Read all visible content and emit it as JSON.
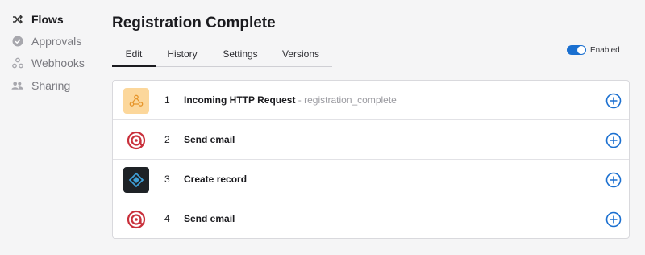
{
  "sidebar": {
    "items": [
      {
        "label": "Flows",
        "icon": "shuffle-icon",
        "active": true
      },
      {
        "label": "Approvals",
        "icon": "check-circle-icon",
        "active": false
      },
      {
        "label": "Webhooks",
        "icon": "webhook-icon",
        "active": false
      },
      {
        "label": "Sharing",
        "icon": "users-icon",
        "active": false
      }
    ]
  },
  "header": {
    "title": "Registration Complete"
  },
  "tabs": [
    {
      "label": "Edit",
      "active": true
    },
    {
      "label": "History",
      "active": false
    },
    {
      "label": "Settings",
      "active": false
    },
    {
      "label": "Versions",
      "active": false
    }
  ],
  "toggle": {
    "label": "Enabled",
    "on": true
  },
  "steps": [
    {
      "number": "1",
      "name": "Incoming HTTP Request",
      "detail": " - registration_complete",
      "icon": "webhook-app-icon"
    },
    {
      "number": "2",
      "name": "Send email",
      "detail": "",
      "icon": "email-at-icon"
    },
    {
      "number": "3",
      "name": "Create record",
      "detail": "",
      "icon": "record-app-icon"
    },
    {
      "number": "4",
      "name": "Send email",
      "detail": "",
      "icon": "email-at-icon"
    }
  ],
  "colors": {
    "accent": "#1a6fd0",
    "email_red": "#c9303b",
    "webhook_bg": "#fcd79b",
    "record_bg": "#1e2226"
  }
}
